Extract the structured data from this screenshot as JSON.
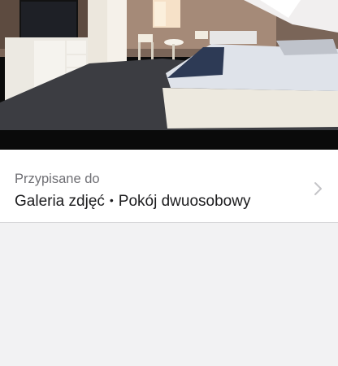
{
  "photo": {
    "icon": "photo-bedroom",
    "description_colors": {
      "floor": "#3c3d42",
      "wall": "#6a5b52",
      "bed_sheet": "#dfe3ea",
      "blanket": "#2d3a55"
    }
  },
  "assigned": {
    "label": "Przypisane do",
    "gallery": "Galeria zdjęć",
    "separator": "•",
    "room": "Pokój dwuosobowy"
  },
  "colors": {
    "label": "#6f6f74",
    "value": "#1c1c1e",
    "chevron": "#c4c4c7",
    "background": "#f2f2f3"
  }
}
